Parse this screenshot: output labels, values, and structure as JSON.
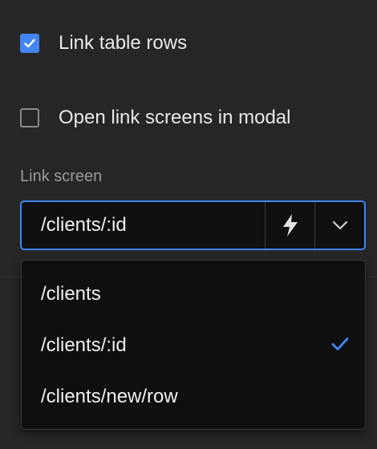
{
  "options_panel": {
    "link_table_rows": {
      "label": "Link table rows",
      "checked": true
    },
    "open_in_modal": {
      "label": "Open link screens in modal",
      "checked": false
    },
    "link_screen": {
      "label": "Link screen",
      "value": "/clients/:id",
      "bind_icon": "lightning-icon",
      "expand_icon": "chevron-down-icon"
    }
  },
  "dropdown": {
    "options": [
      {
        "label": "/clients",
        "selected": false
      },
      {
        "label": "/clients/:id",
        "selected": true
      },
      {
        "label": "/clients/new/row",
        "selected": false
      }
    ]
  },
  "colors": {
    "accent": "#4285f4",
    "background": "#262626",
    "input_background": "#0f0f0f"
  }
}
